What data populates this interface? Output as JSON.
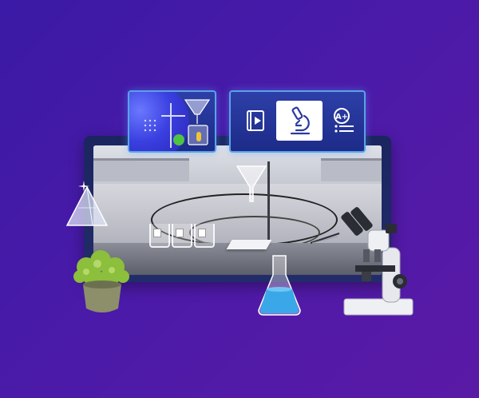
{
  "toolbar": {
    "buttons": [
      {
        "name": "video",
        "icon": "play-video-icon",
        "active": false
      },
      {
        "name": "microscope",
        "icon": "microscope-icon",
        "active": true
      },
      {
        "name": "assessment",
        "icon": "grade-list-icon",
        "active": false
      }
    ],
    "assessment_badge": "A+"
  },
  "scene": {
    "beaker_labels": [
      "",
      "",
      ""
    ]
  },
  "colors": {
    "background": "#4a1aa8",
    "panel": "#2d3fa8",
    "panel_border": "#5aa3e6",
    "flask_liquid": "#3aa7e8"
  }
}
